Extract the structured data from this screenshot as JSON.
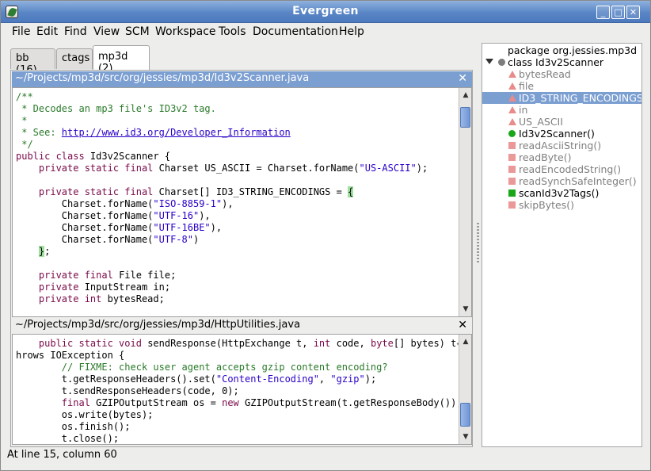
{
  "window": {
    "title": "Evergreen"
  },
  "menu": [
    "File",
    "Edit",
    "Find",
    "View",
    "SCM",
    "Workspace",
    "Tools",
    "Documentation",
    "Help"
  ],
  "tabs": [
    {
      "label": "bb (16)",
      "active": false
    },
    {
      "label": "ctags",
      "active": false
    },
    {
      "label": "mp3d (2)",
      "active": true
    }
  ],
  "editor1": {
    "path": "~/Projects/mp3d/src/org/jessies/mp3d/Id3v2Scanner.java",
    "close": "✕",
    "lines": [
      [
        [
          "cm",
          "/**"
        ]
      ],
      [
        [
          "cm",
          " * Decodes an mp3 file's ID3v2 tag."
        ]
      ],
      [
        [
          "cm",
          " *"
        ]
      ],
      [
        [
          "cm",
          " * See: "
        ],
        [
          "lnk",
          "http://www.id3.org/Developer_Information"
        ]
      ],
      [
        [
          "cm",
          " */"
        ]
      ],
      [
        [
          "kw",
          "public class "
        ],
        [
          "",
          "Id3v2Scanner {"
        ]
      ],
      [
        [
          "",
          "    "
        ],
        [
          "kw",
          "private static final "
        ],
        [
          "",
          "Charset US_ASCII = Charset.forName("
        ],
        [
          "str",
          "\"US-ASCII\""
        ],
        [
          "",
          ");"
        ]
      ],
      [
        [
          "",
          ""
        ]
      ],
      [
        [
          "",
          "    "
        ],
        [
          "kw",
          "private static final "
        ],
        [
          "",
          "Charset[] ID3_STRING_ENCODINGS = "
        ],
        [
          "hl",
          "{"
        ]
      ],
      [
        [
          "",
          "        Charset.forName("
        ],
        [
          "str",
          "\"ISO-8859-1\""
        ],
        [
          "",
          "),"
        ]
      ],
      [
        [
          "",
          "        Charset.forName("
        ],
        [
          "str",
          "\"UTF-16\""
        ],
        [
          "",
          "),"
        ]
      ],
      [
        [
          "",
          "        Charset.forName("
        ],
        [
          "str",
          "\"UTF-16BE\""
        ],
        [
          "",
          "),"
        ]
      ],
      [
        [
          "",
          "        Charset.forName("
        ],
        [
          "str",
          "\"UTF-8\""
        ],
        [
          "",
          ")"
        ]
      ],
      [
        [
          "",
          "    "
        ],
        [
          "hl",
          "}"
        ],
        [
          "",
          ";"
        ]
      ],
      [
        [
          "",
          ""
        ]
      ],
      [
        [
          "",
          "    "
        ],
        [
          "kw",
          "private final "
        ],
        [
          "",
          "File file;"
        ]
      ],
      [
        [
          "",
          "    "
        ],
        [
          "kw",
          "private "
        ],
        [
          "",
          "InputStream in;"
        ]
      ],
      [
        [
          "",
          "    "
        ],
        [
          "kw",
          "private int "
        ],
        [
          "",
          "bytesRead;"
        ]
      ]
    ]
  },
  "editor2": {
    "path": "~/Projects/mp3d/src/org/jessies/mp3d/HttpUtilities.java",
    "close": "✕",
    "lines": [
      [
        [
          "",
          "    "
        ],
        [
          "kw",
          "public static void "
        ],
        [
          "",
          "sendResponse(HttpExchange t, "
        ],
        [
          "kw",
          "int "
        ],
        [
          "",
          "code, "
        ],
        [
          "kw",
          "byte"
        ],
        [
          "",
          "[] bytes) t"
        ],
        [
          "muted",
          "↩"
        ]
      ],
      [
        [
          "",
          "hrows IOException {"
        ]
      ],
      [
        [
          "",
          "        "
        ],
        [
          "cm",
          "// FIXME: check user agent accepts gzip content encoding?"
        ]
      ],
      [
        [
          "",
          "        t.getResponseHeaders().set("
        ],
        [
          "str",
          "\"Content-Encoding\""
        ],
        [
          "",
          ", "
        ],
        [
          "str",
          "\"gzip\""
        ],
        [
          "",
          ");"
        ]
      ],
      [
        [
          "",
          "        t.sendResponseHeaders(code, 0);"
        ]
      ],
      [
        [
          "",
          "        "
        ],
        [
          "kw",
          "final "
        ],
        [
          "",
          "GZIPOutputStream os = "
        ],
        [
          "kw",
          "new "
        ],
        [
          "",
          "GZIPOutputStream(t.getResponseBody());"
        ]
      ],
      [
        [
          "",
          "        os.write(bytes);"
        ]
      ],
      [
        [
          "",
          "        os.finish();"
        ]
      ],
      [
        [
          "",
          "        t.close();"
        ]
      ]
    ]
  },
  "tree": [
    {
      "label": "package org.jessies.mp3d",
      "marker": "none",
      "indent": 0,
      "muted": false,
      "selected": false
    },
    {
      "label": "class Id3v2Scanner",
      "marker": "dot-grey",
      "indent": 0,
      "muted": false,
      "selected": false,
      "expander": true
    },
    {
      "label": "bytesRead",
      "marker": "tri",
      "indent": 1,
      "muted": true,
      "selected": false
    },
    {
      "label": "file",
      "marker": "tri",
      "indent": 1,
      "muted": true,
      "selected": false
    },
    {
      "label": "ID3_STRING_ENCODINGS",
      "marker": "tri",
      "indent": 1,
      "muted": false,
      "selected": true
    },
    {
      "label": "in",
      "marker": "tri",
      "indent": 1,
      "muted": true,
      "selected": false
    },
    {
      "label": "US_ASCII",
      "marker": "tri",
      "indent": 1,
      "muted": true,
      "selected": false
    },
    {
      "label": "Id3v2Scanner()",
      "marker": "dot-green",
      "indent": 1,
      "muted": false,
      "selected": false
    },
    {
      "label": "readAsciiString()",
      "marker": "sq-pink",
      "indent": 1,
      "muted": true,
      "selected": false
    },
    {
      "label": "readByte()",
      "marker": "sq-pink",
      "indent": 1,
      "muted": true,
      "selected": false
    },
    {
      "label": "readEncodedString()",
      "marker": "sq-pink",
      "indent": 1,
      "muted": true,
      "selected": false
    },
    {
      "label": "readSynchSafeInteger()",
      "marker": "sq-pink",
      "indent": 1,
      "muted": true,
      "selected": false
    },
    {
      "label": "scanId3v2Tags()",
      "marker": "sq-green",
      "indent": 1,
      "muted": false,
      "selected": false
    },
    {
      "label": "skipBytes()",
      "marker": "sq-pink",
      "indent": 1,
      "muted": true,
      "selected": false
    }
  ],
  "status": {
    "text": "At line 15, column 60"
  },
  "icons": {
    "app": "evergreen-leaf-icon",
    "minimize": "minimize-icon",
    "maximize": "maximize-icon",
    "close": "close-icon"
  },
  "colors": {
    "selection": "#7c9fd2",
    "comment": "#2a7a2a",
    "keyword": "#7a0a4a",
    "string": "#2a00c8",
    "bracket_highlight": "#9fe09f"
  }
}
